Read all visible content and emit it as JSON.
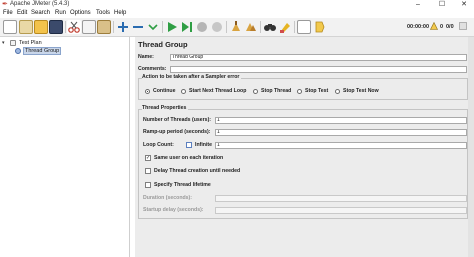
{
  "window": {
    "title": "Apache JMeter (5.4.3)",
    "min_glyph": "–",
    "max_glyph": "☐",
    "close_glyph": "✕"
  },
  "menu": [
    "File",
    "Edit",
    "Search",
    "Run",
    "Options",
    "Tools",
    "Help"
  ],
  "toolbar": {
    "status_time": "00:00:00",
    "warn_count": "0",
    "thread_count": "0/0",
    "icons": [
      "new-icon",
      "templates-icon",
      "open-icon",
      "save-icon",
      "cut-icon",
      "copy-icon",
      "paste-icon",
      "expand-icon",
      "collapse-icon",
      "toggle-icon",
      "start-icon",
      "start-no-pauses-icon",
      "stop-icon",
      "shutdown-icon",
      "clear-icon",
      "clear-all-icon",
      "search-icon",
      "reset-search-icon",
      "function-helper-icon",
      "help-icon"
    ]
  },
  "tree": {
    "root_label": "Test Plan",
    "child_label": "Thread Group"
  },
  "panel": {
    "title": "Thread Group",
    "name_label": "Name:",
    "name_value": "Thread Group",
    "comments_label": "Comments:",
    "comments_value": "",
    "error_group": {
      "title": "Action to be taken after a Sampler error",
      "options": [
        "Continue",
        "Start Next Thread Loop",
        "Stop Thread",
        "Stop Test",
        "Stop Test Now"
      ],
      "selected": "Continue"
    },
    "thread_props": {
      "title": "Thread Properties",
      "num_threads_label": "Number of Threads (users):",
      "num_threads_value": "1",
      "ramp_label": "Ramp-up period (seconds):",
      "ramp_value": "1",
      "loop_label": "Loop Count:",
      "infinite_label": "Infinite",
      "loop_value": "1",
      "same_user_label": "Same user on each iteration",
      "delay_label": "Delay Thread creation until needed",
      "specify_label": "Specify Thread lifetime",
      "duration_label": "Duration (seconds):",
      "startup_label": "Startup delay (seconds):"
    }
  },
  "colors": {
    "accent": "#2f9e44",
    "toolbar_bg": "#f2f2f2",
    "panel_bg": "#ececec",
    "selection": "#c9d6ea"
  }
}
